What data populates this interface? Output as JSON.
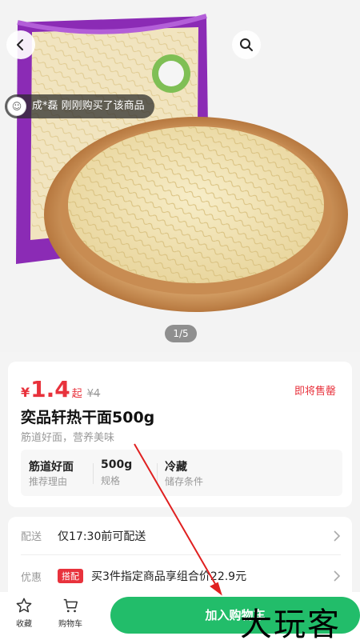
{
  "nav": {
    "back_icon": "arrow-left-icon",
    "search_icon": "search-icon"
  },
  "toast": {
    "text": "成*磊 刚刚购买了该商品"
  },
  "gallery": {
    "pager": "1/5"
  },
  "product": {
    "currency": "¥",
    "price": "1.4",
    "price_suffix": "起",
    "original_price": "¥4",
    "status": "即将售罄",
    "title": "奕品轩热干面500g",
    "subtitle": "筋道好面，营养美味",
    "attributes": [
      {
        "value": "筋道好面",
        "label": "推荐理由"
      },
      {
        "value": "500g",
        "label": "规格"
      },
      {
        "value": "冷藏",
        "label": "储存条件"
      }
    ]
  },
  "shipping": {
    "delivery_label": "配送",
    "delivery_text": "仅17:30前可配送",
    "promo_label": "优惠",
    "promo_tag": "搭配",
    "promo_text": "买3件指定商品享组合价22.9元"
  },
  "bottom": {
    "fav_label": "收藏",
    "cart_label": "购物车",
    "add_to_cart": "加入购物车"
  },
  "watermark": "大玩客",
  "colors": {
    "accent_green": "#22bd6a",
    "price_red": "#e8323c",
    "package_purple": "#8b2bb5"
  }
}
